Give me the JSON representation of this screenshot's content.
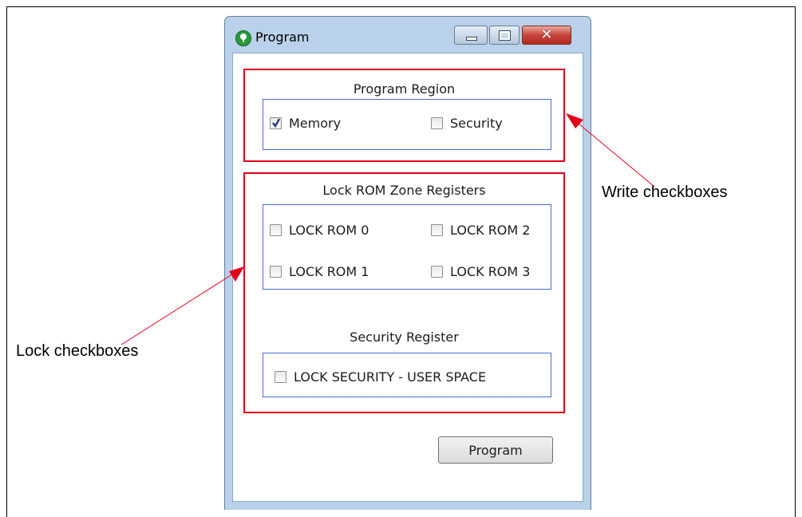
{
  "window": {
    "title": "Program",
    "close_glyph": "✕"
  },
  "program_region": {
    "title": "Program Region",
    "memory": {
      "label": "Memory",
      "checked": true
    },
    "security": {
      "label": "Security",
      "checked": false
    }
  },
  "lock_rom": {
    "title": "Lock ROM Zone Registers",
    "items": [
      {
        "label": "LOCK ROM 0",
        "checked": false
      },
      {
        "label": "LOCK ROM 2",
        "checked": false
      },
      {
        "label": "LOCK ROM 1",
        "checked": false
      },
      {
        "label": "LOCK ROM 3",
        "checked": false
      }
    ]
  },
  "security_register": {
    "title": "Security Register",
    "lock_security": {
      "label": "LOCK SECURITY - USER SPACE",
      "checked": false
    }
  },
  "program_button": {
    "label": "Program"
  },
  "annotations": {
    "write": "Write checkboxes",
    "lock": "Lock checkboxes"
  },
  "colors": {
    "highlight_box": "#e3001b",
    "group_border": "#4a6bd6",
    "window_frame": "#b9d1ea"
  },
  "icons": {
    "app": "green-tree-icon",
    "checkmark": "check-icon"
  }
}
